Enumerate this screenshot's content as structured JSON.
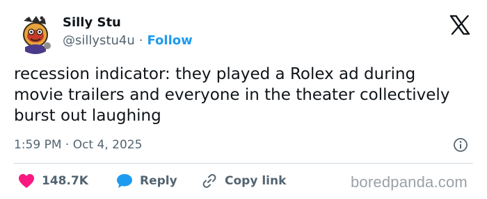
{
  "author": {
    "name": "Silly Stu",
    "handle": "@sillystu4u",
    "separator": "·",
    "follow_label": "Follow"
  },
  "tweet": {
    "text": "recession indicator: they played a Rolex ad during movie trailers and everyone in the theater collectively burst out laughing",
    "timestamp": "1:59 PM · Oct 4, 2025"
  },
  "actions": {
    "likes_count": "148.7K",
    "reply_label": "Reply",
    "copy_link_label": "Copy link"
  },
  "icons": {
    "platform_logo": "x-logo-icon",
    "info": "info-icon",
    "like": "heart-icon",
    "reply": "reply-bubble-icon",
    "copy": "link-icon"
  },
  "watermark": "boredpanda.com",
  "colors": {
    "text": "#0f1419",
    "secondary": "#536471",
    "accent": "#1d9bf0",
    "like": "#f91880",
    "divider": "#cfd9de",
    "watermark": "#9aa1a7"
  }
}
